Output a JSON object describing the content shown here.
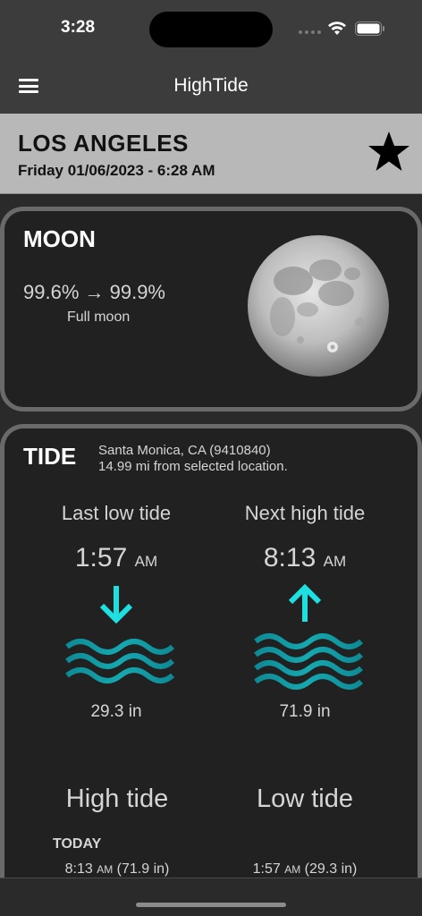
{
  "status_bar": {
    "time": "3:28"
  },
  "nav": {
    "title": "HighTide"
  },
  "location": {
    "name": "LOS ANGELES",
    "datetime": "Friday 01/06/2023 - 6:28 AM"
  },
  "moon": {
    "title": "MOON",
    "illumination": "99.6% → 99.9%",
    "phase": "Full moon"
  },
  "tide": {
    "title": "TIDE",
    "station": "Santa Monica, CA (9410840)",
    "distance": "14.99 mi from selected location.",
    "last": {
      "label": "Last low tide",
      "time": "1:57",
      "ampm": "AM",
      "height": "29.3 in",
      "direction": "down-arrow-icon"
    },
    "next": {
      "label": "Next high tide",
      "time": "8:13",
      "ampm": "AM",
      "height": "71.9 in",
      "direction": "up-arrow-icon"
    },
    "high_label": "High tide",
    "low_label": "Low tide",
    "day": "TODAY",
    "high_entry": {
      "time": "8:13",
      "ampm": "AM",
      "height": "(71.9 in)"
    },
    "low_entry": {
      "time": "1:57",
      "ampm": "AM",
      "height": "(29.3 in)"
    }
  },
  "colors": {
    "accent": "#1fe0e0",
    "wave_dark": "#0e8a95",
    "background": "#212121"
  }
}
